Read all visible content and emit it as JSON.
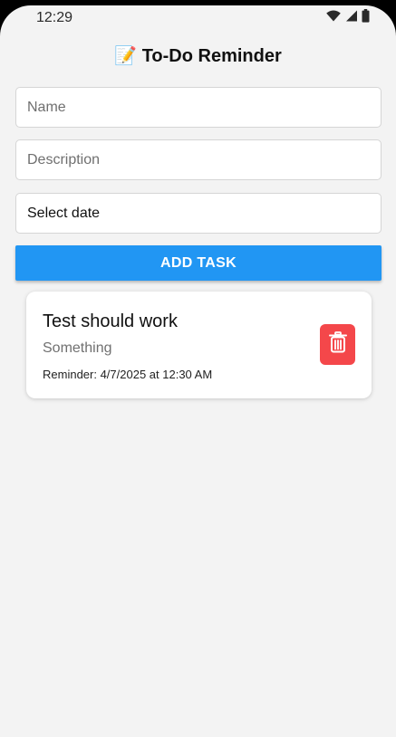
{
  "status_bar": {
    "time": "12:29",
    "icons": [
      "wifi-icon",
      "signal-icon",
      "battery-icon"
    ]
  },
  "app": {
    "title": "📝 To-Do Reminder"
  },
  "form": {
    "name_placeholder": "Name",
    "name_value": "",
    "description_placeholder": "Description",
    "description_value": "",
    "date_label": "Select date",
    "add_button_label": "ADD TASK"
  },
  "tasks": [
    {
      "title": "Test should work",
      "description": "Something",
      "reminder": "Reminder: 4/7/2025 at 12:30 AM",
      "delete_icon": "trash-icon"
    }
  ],
  "colors": {
    "accent": "#2196f3",
    "delete": "#f4474a",
    "background": "#f3f3f3"
  }
}
